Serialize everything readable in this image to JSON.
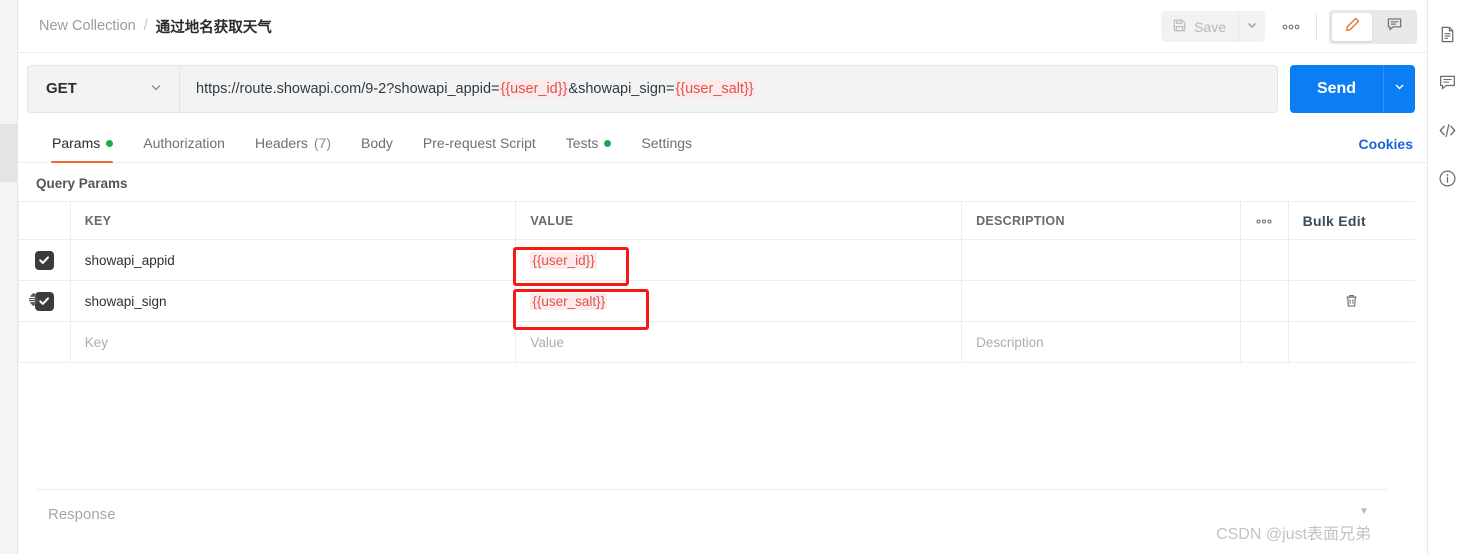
{
  "breadcrumb": {
    "collection": "New Collection",
    "separator": "/",
    "current": "通过地名获取天气"
  },
  "header": {
    "save_label": "Save",
    "save_icon": "floppy-disk-icon",
    "save_caret_icon": "chevron-down-icon",
    "more_icon": "ellipsis-icon",
    "more_label": "•••",
    "edit_icon": "pencil-icon",
    "comment_icon": "comment-icon",
    "accent_orange": "#ef6c23"
  },
  "request": {
    "method": "GET",
    "method_caret_icon": "chevron-down-icon",
    "url_parts": [
      {
        "text": "https://route.showapi.com/9-2?showapi_appid=",
        "variable": false
      },
      {
        "text": "{{user_id}}",
        "variable": true
      },
      {
        "text": "&showapi_sign=",
        "variable": false
      },
      {
        "text": "{{user_salt}}",
        "variable": true
      }
    ],
    "url_full": "https://route.showapi.com/9-2?showapi_appid={{user_id}}&showapi_sign={{user_salt}}",
    "send_label": "Send",
    "send_caret_icon": "chevron-down-icon",
    "send_color": "#0b7ef5"
  },
  "tabs": [
    {
      "label": "Params",
      "active": true,
      "dot": true,
      "count": ""
    },
    {
      "label": "Authorization",
      "active": false,
      "dot": false,
      "count": ""
    },
    {
      "label": "Headers",
      "active": false,
      "dot": false,
      "count": "(7)"
    },
    {
      "label": "Body",
      "active": false,
      "dot": false,
      "count": ""
    },
    {
      "label": "Pre-request Script",
      "active": false,
      "dot": false,
      "count": ""
    },
    {
      "label": "Tests",
      "active": false,
      "dot": true,
      "count": ""
    },
    {
      "label": "Settings",
      "active": false,
      "dot": false,
      "count": ""
    }
  ],
  "cookies_label": "Cookies",
  "params": {
    "section_title": "Query Params",
    "columns": {
      "key": "KEY",
      "value": "VALUE",
      "description": "DESCRIPTION"
    },
    "more_label": "•••",
    "bulk_edit_label": "Bulk Edit",
    "rows": [
      {
        "checked": true,
        "key": "showapi_appid",
        "value": "{{user_id}}",
        "value_is_variable": true,
        "description": "",
        "has_drag_handle": false,
        "has_trash": false,
        "placeholder_row": false
      },
      {
        "checked": true,
        "key": "showapi_sign",
        "value": "{{user_salt}}",
        "value_is_variable": true,
        "description": "",
        "has_drag_handle": true,
        "has_trash": true,
        "placeholder_row": false
      },
      {
        "checked": false,
        "key": "Key",
        "value": "Value",
        "value_is_variable": false,
        "description": "Description",
        "has_drag_handle": false,
        "has_trash": false,
        "placeholder_row": true
      }
    ]
  },
  "annotations": [
    {
      "name": "value-user-id-highlight",
      "color": "#f51a11"
    },
    {
      "name": "value-user-salt-highlight",
      "color": "#f51a11"
    }
  ],
  "response": {
    "label": "Response",
    "caret_icon": "triangle-down-icon",
    "caret_glyph": "▼"
  },
  "watermark": "CSDN @just表面兄弟",
  "right_rail": [
    {
      "icon": "document-icon"
    },
    {
      "icon": "comment-icon"
    },
    {
      "icon": "code-icon"
    },
    {
      "icon": "info-circle-icon"
    }
  ]
}
